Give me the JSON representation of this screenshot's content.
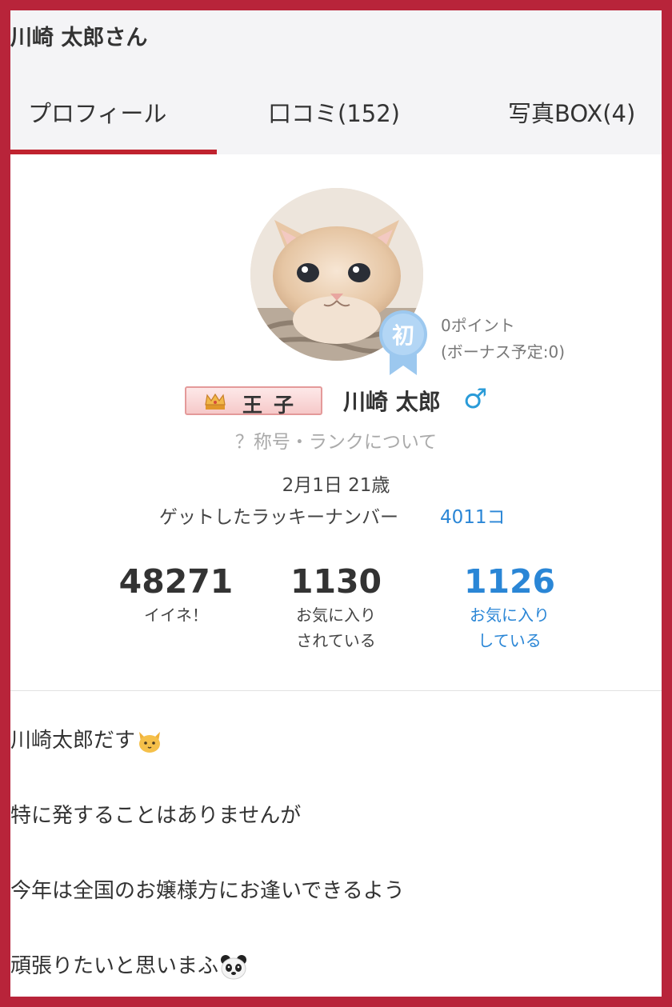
{
  "header": {
    "user_title": "川崎 太郎さん",
    "tabs": [
      {
        "label": "プロフィール"
      },
      {
        "label": "口コミ(152)"
      },
      {
        "label": "写真BOX(4)"
      }
    ]
  },
  "profile": {
    "rank_badge_char": "初",
    "points": "0ポイント",
    "bonus": "(ボーナス予定:0)",
    "title_tag": "王子",
    "name": "川崎 太郎",
    "gender_symbol": "♂",
    "rank_link": "？称号・ランクについて",
    "birthday": "2月1日 21歳",
    "lucky_label": "ゲットしたラッキーナンバー",
    "lucky_value": "4011コ"
  },
  "stats": [
    {
      "value": "48271",
      "label1": "イイネ！",
      "label2": ""
    },
    {
      "value": "1130",
      "label1": "お気に入り",
      "label2": "されている"
    },
    {
      "value": "1126",
      "label1": "お気に入り",
      "label2": "している"
    }
  ],
  "bio": [
    "川崎太郎だす",
    "特に発することはありませんが",
    "今年は全国のお嬢様方にお逢いできるよう",
    "頑張りたいと思いまふ"
  ],
  "colors": {
    "frame": "#b8243a",
    "accent": "#c0232f",
    "link_blue": "#2a86d6",
    "gender_blue": "#2a9bd8"
  }
}
